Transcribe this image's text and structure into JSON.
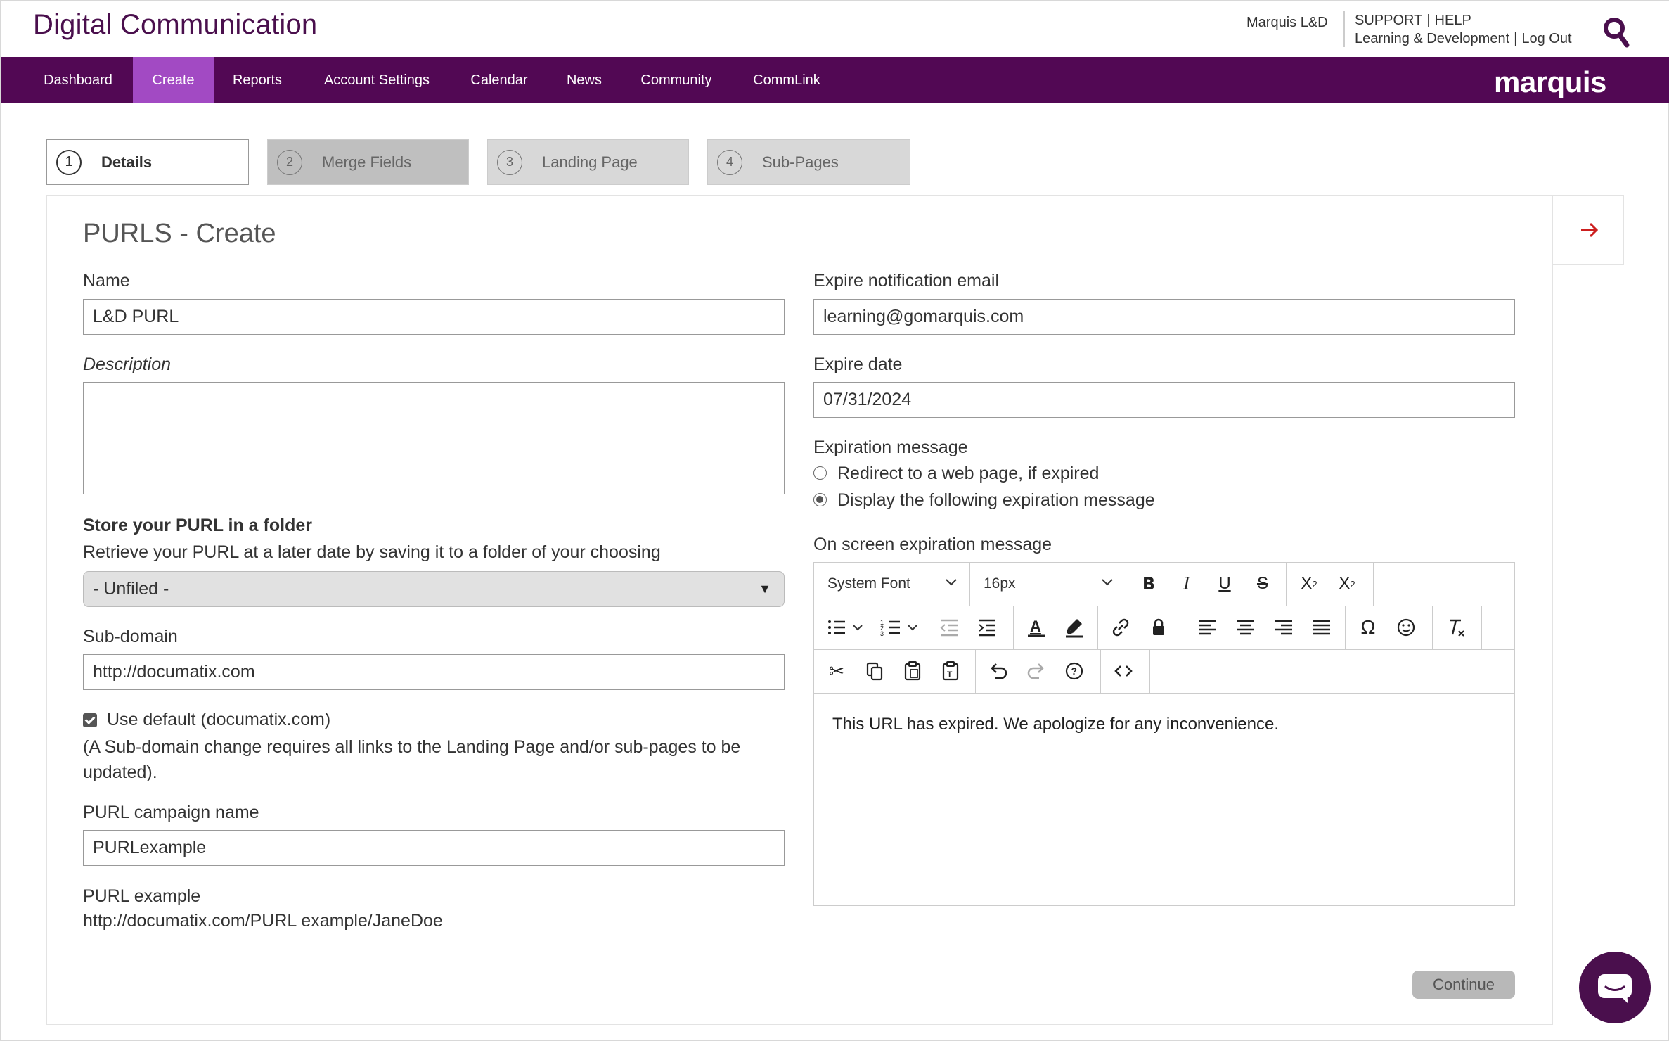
{
  "header": {
    "app_title": "Digital Communication",
    "user": "Marquis L&D",
    "support": "SUPPORT",
    "help": "HELP",
    "org": "Learning & Development",
    "logout": "Log Out",
    "search_icon": "search-icon"
  },
  "nav": {
    "items": [
      "Dashboard",
      "Create",
      "Reports",
      "Account Settings",
      "Calendar",
      "News",
      "Community",
      "CommLink"
    ],
    "active": "Create",
    "brand": "marquis",
    "bar_color": "#520854",
    "active_color": "#a24ac3"
  },
  "steps": [
    {
      "num": "1",
      "label": "Details"
    },
    {
      "num": "2",
      "label": "Merge Fields"
    },
    {
      "num": "3",
      "label": "Landing Page"
    },
    {
      "num": "4",
      "label": "Sub-Pages"
    }
  ],
  "form": {
    "title": "PURLS - Create",
    "name_label": "Name",
    "name_value": "L&D PURL",
    "description_label": "Description",
    "folder_heading": "Store your PURL in a folder",
    "folder_help": "Retrieve your PURL at a later date by saving it to a folder of your choosing",
    "folder_value": "- Unfiled -",
    "subdomain_label": "Sub-domain",
    "subdomain_value": "http://documatix.com",
    "use_default_label": "Use default (documatix.com)",
    "subdomain_note": "(A Sub-domain change requires all links to the Landing Page and/or sub-pages to be updated).",
    "campaign_label": "PURL campaign name",
    "campaign_value": "PURLexample",
    "example_label": "PURL example",
    "example_value": "http://documatix.com/PURL example/JaneDoe",
    "expire_email_label": "Expire notification email",
    "expire_email_value": "learning@gomarquis.com",
    "expire_date_label": "Expire date",
    "expire_date_value": "07/31/2024",
    "expiration_message_label": "Expiration message",
    "radio_redirect": "Redirect to a web page, if expired",
    "radio_display": "Display the following expiration message",
    "onscreen_label": "On screen expiration message",
    "continue_label": "Continue"
  },
  "editor": {
    "font": "System Font",
    "size": "16px",
    "content": "This URL has expired. We apologize for any inconvenience."
  }
}
